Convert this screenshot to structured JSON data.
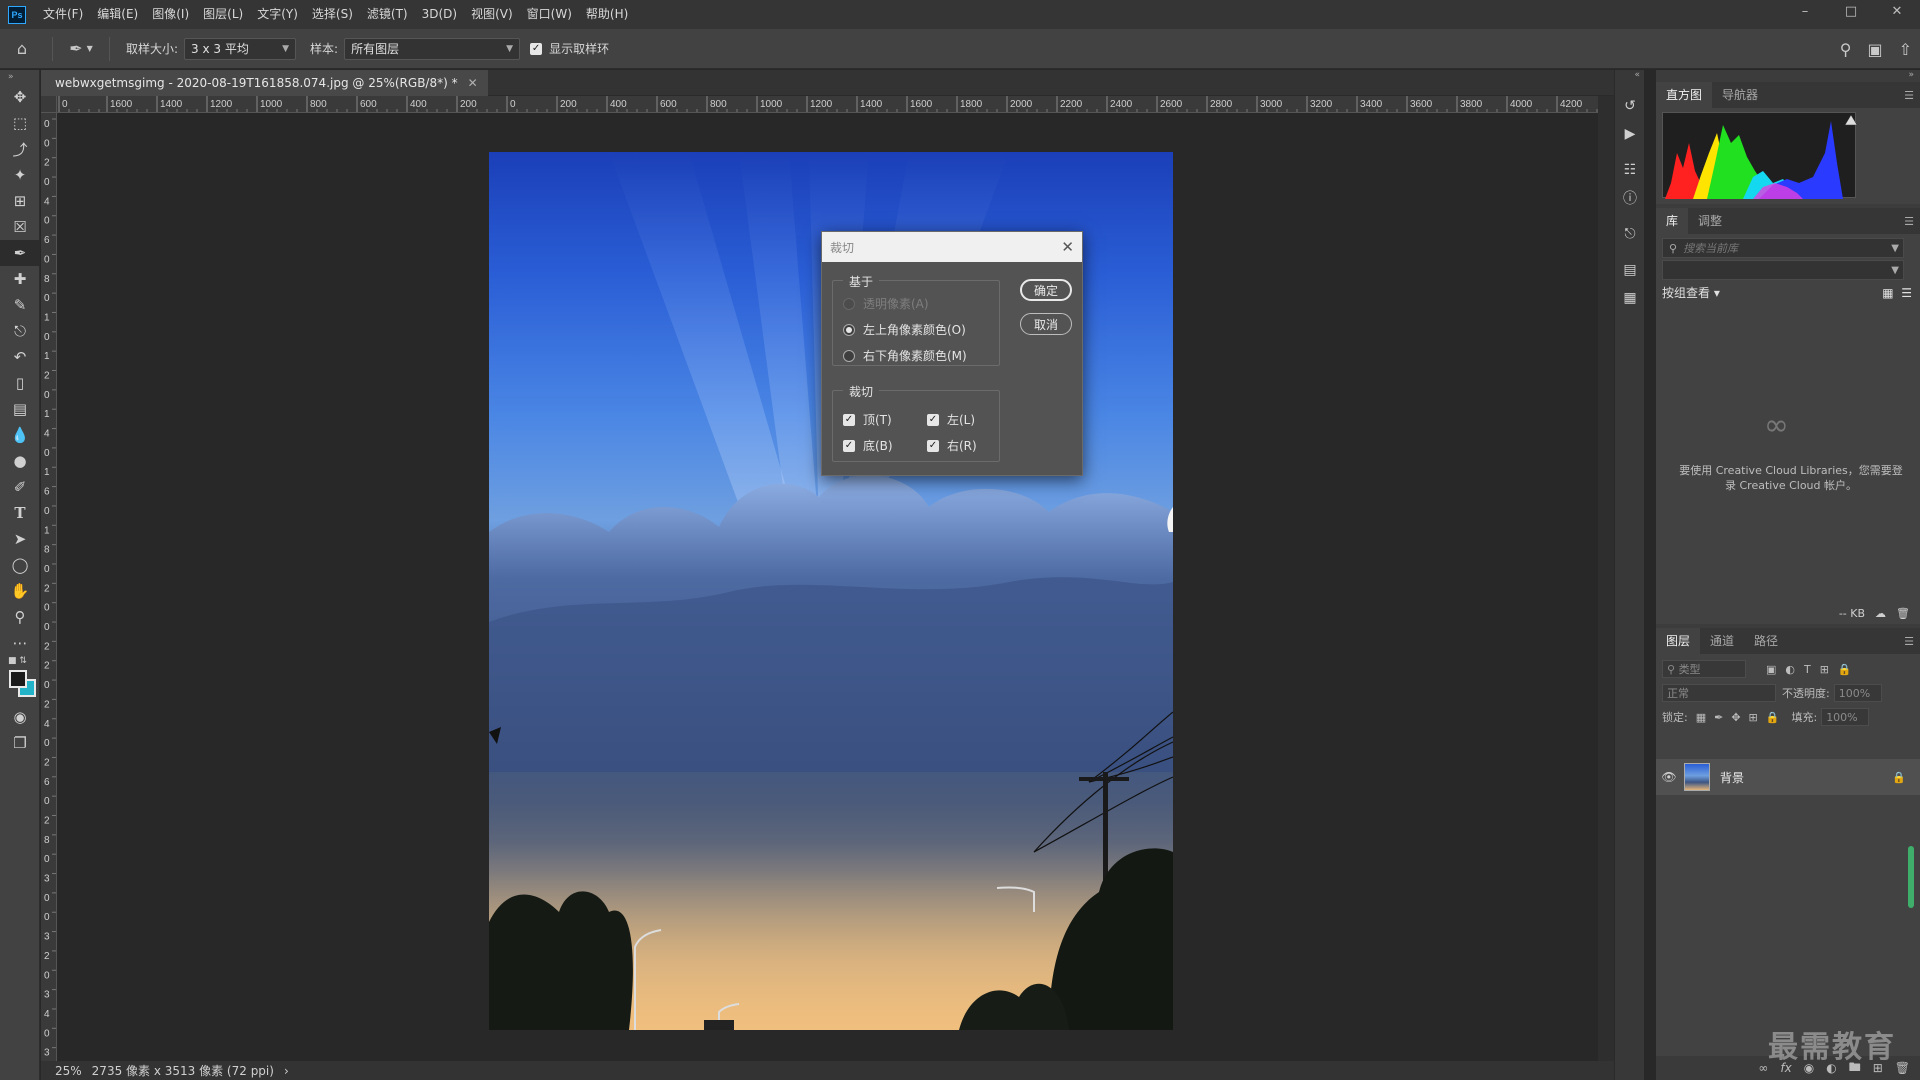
{
  "app": {
    "logo": "Ps",
    "menus": [
      "文件(F)",
      "编辑(E)",
      "图像(I)",
      "图层(L)",
      "文字(Y)",
      "选择(S)",
      "滤镜(T)",
      "3D(D)",
      "视图(V)",
      "窗口(W)",
      "帮助(H)"
    ]
  },
  "options": {
    "sample_size_label": "取样大小:",
    "sample_size_value": "3 x 3 平均",
    "sample_label": "样本:",
    "sample_value": "所有图层",
    "show_ring_label": "显示取样环",
    "show_ring_checked": true
  },
  "document": {
    "tab_title": "webwxgetmsgimg - 2020-08-19T161858.074.jpg @ 25%(RGB/8*) *",
    "ruler_h_labels": [
      "0",
      "1600",
      "1400",
      "1200",
      "1000",
      "800",
      "600",
      "400",
      "200",
      "0",
      "200",
      "400",
      "600",
      "800",
      "1000",
      "1200",
      "1400",
      "1600",
      "1800",
      "2000",
      "2200",
      "2400",
      "2600",
      "2800",
      "3000",
      "3200",
      "3400",
      "3600",
      "3800",
      "4000",
      "4200",
      "4"
    ],
    "ruler_v_labels": [
      "0",
      "0",
      "2",
      "0",
      "4",
      "0",
      "6",
      "0",
      "8",
      "0",
      "1",
      "0",
      "1",
      "2",
      "0",
      "1",
      "4",
      "0",
      "1",
      "6",
      "0",
      "1",
      "8",
      "0",
      "2",
      "0",
      "0",
      "2",
      "2",
      "0",
      "2",
      "4",
      "0",
      "2",
      "6",
      "0",
      "2",
      "8",
      "0",
      "3",
      "0",
      "0",
      "3",
      "2",
      "0",
      "3",
      "4",
      "0",
      "3"
    ],
    "zoom": "25%",
    "dimensions": "2735 像素 x 3513 像素 (72 ppi)"
  },
  "trim_dialog": {
    "title": "裁切",
    "based_on_group": "基于",
    "based_on_options": [
      {
        "label": "透明像素(A)",
        "checked": false,
        "disabled": true
      },
      {
        "label": "左上角像素颜色(O)",
        "checked": true,
        "disabled": false
      },
      {
        "label": "右下角像素颜色(M)",
        "checked": false,
        "disabled": false
      }
    ],
    "trim_away_group": "裁切",
    "trim_options": {
      "top": "顶(T)",
      "left": "左(L)",
      "bottom": "底(B)",
      "right": "右(R)"
    },
    "ok_label": "确定",
    "cancel_label": "取消"
  },
  "panels": {
    "histogram_tabs": [
      "直方图",
      "导航器"
    ],
    "library_tabs": [
      "库",
      "调整"
    ],
    "library_search_placeholder": "搜索当前库",
    "library_view_label": "按组查看",
    "library_message": "要使用 Creative Cloud Libraries，您需要登录 Creative Cloud 帐户。",
    "library_size": "-- KB",
    "layers_tabs": [
      "图层",
      "通道",
      "路径"
    ],
    "layers_kind_placeholder": "类型",
    "blend_mode": "正常",
    "opacity_label": "不透明度:",
    "opacity_value": "100%",
    "lock_label": "锁定:",
    "fill_label": "填充:",
    "fill_value": "100%",
    "layer_name": "背景"
  },
  "watermark": "最需教育",
  "colors": {
    "accent": "#31a8ff",
    "background_swatch": "#23b3c8",
    "foreground_swatch": "#1a1a1a"
  }
}
